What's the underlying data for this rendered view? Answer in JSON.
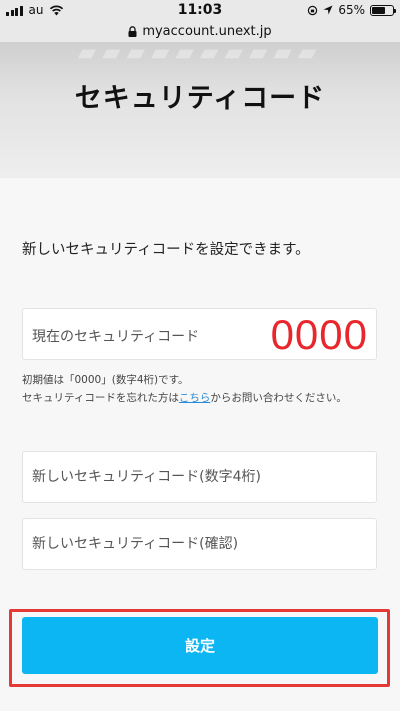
{
  "status_bar": {
    "carrier": "au",
    "time": "11:03",
    "battery": "65%",
    "battery_level": 0.65
  },
  "browser": {
    "url": "myaccount.unext.jp"
  },
  "header": {
    "title": "セキュリティコード"
  },
  "main": {
    "intro": "新しいセキュリティコードを設定できます。",
    "current_code": {
      "label": "現在のセキュリティコード",
      "value": "0000"
    },
    "notes": {
      "line1": "初期値は「0000」(数字4桁)です。",
      "line2_prefix": "セキュリティコードを忘れた方は",
      "line2_link": "こちら",
      "line2_suffix": "からお問い合わせください。"
    },
    "new_code": {
      "placeholder": "新しいセキュリティコード(数字4桁)"
    },
    "confirm_code": {
      "placeholder": "新しいセキュリティコード(確認)"
    },
    "submit_label": "設定"
  },
  "colors": {
    "accent": "#0cb6f2",
    "code_red": "#e8262c",
    "highlight": "#e53935",
    "link": "#2a8bd8"
  },
  "icons": [
    "signal-icon",
    "wifi-icon",
    "lock-icon",
    "orientation-lock-icon",
    "location-icon",
    "battery-icon"
  ]
}
